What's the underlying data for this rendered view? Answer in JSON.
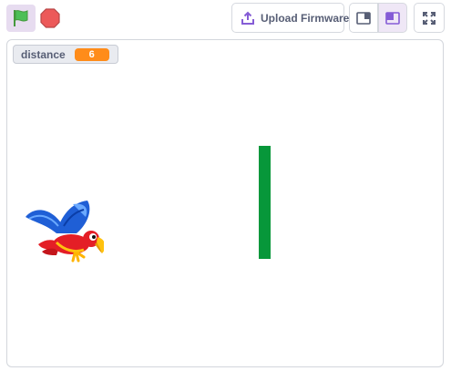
{
  "toolbar": {
    "green_flag_icon": "flag-icon",
    "stop_icon": "stop-icon",
    "upload_label": "Upload Firmware",
    "upload_icon": "upload-icon",
    "small_stage_icon": "small-stage-icon",
    "normal_stage_icon": "normal-stage-icon",
    "fullscreen_icon": "fullscreen-icon"
  },
  "stage": {
    "monitor": {
      "label": "distance",
      "value": "6"
    },
    "sprites": [
      "parrot",
      "pipe"
    ]
  },
  "colors": {
    "accent": "#855cd6",
    "monitor_value_bg": "#ff8c1a",
    "pipe": "#07973a",
    "flag": "#4cbf56",
    "stop": "#ec5959"
  }
}
